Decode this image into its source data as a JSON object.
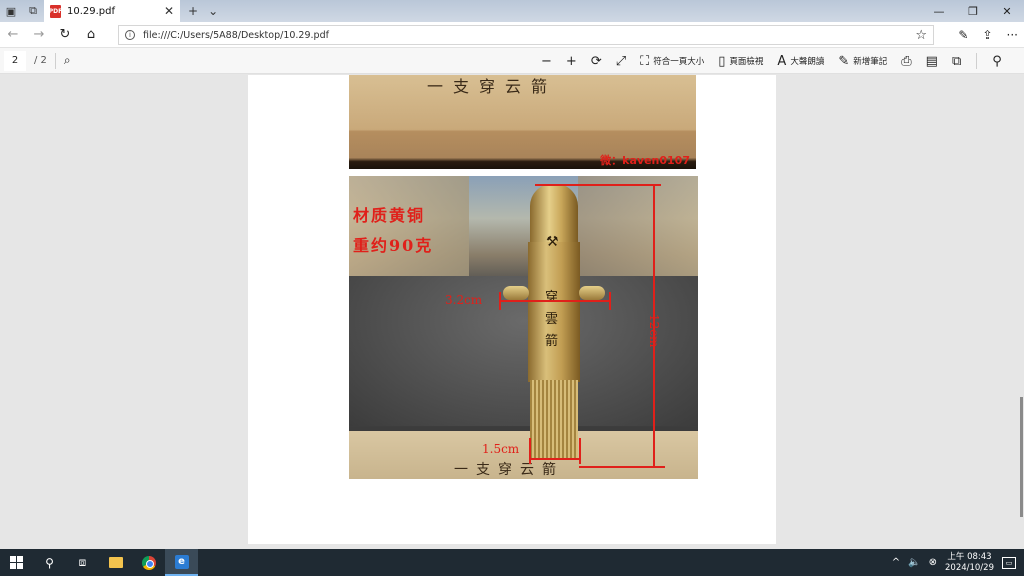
{
  "tab": {
    "title": "10.29.pdf",
    "close": "✕",
    "new": "+",
    "dropdown": "⌄"
  },
  "window": {
    "minimize": "—",
    "restore": "❐",
    "close": "✕"
  },
  "address": {
    "url": "file:///C:/Users/5A88/Desktop/10.29.pdf",
    "info": "i"
  },
  "pdf_toolbar": {
    "page_current": "2",
    "page_total": "/ 2",
    "fit_label": "符合一頁大小",
    "page_view_label": "頁面檢視",
    "read_aloud_label": "大聲朗讀",
    "notes_label": "新增筆記"
  },
  "photo1": {
    "box_text": "一支穿云箭",
    "watermark": "微：kaven0107"
  },
  "photo2": {
    "material": "材质黄铜",
    "weight": "重约90克",
    "width_label": "3.2cm",
    "height_label": "12cm",
    "base_label": "1.5cm",
    "tube_chars": [
      "穿",
      "雲",
      "箭"
    ],
    "box_text": "一支穿云箭"
  },
  "taskbar": {
    "time": "上午 08:43",
    "date": "2024/10/29",
    "tray_arrow": "^",
    "volume": "🔈"
  },
  "colors": {
    "annotation_red": "#e0201a",
    "taskbar": "#1f2a33",
    "tab_bar": "#c3cfdd"
  }
}
